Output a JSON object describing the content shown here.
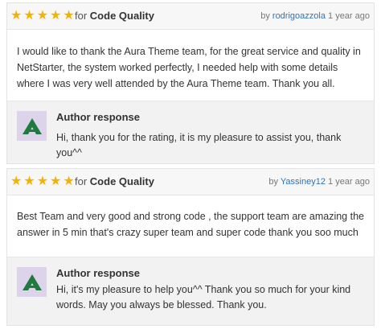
{
  "colors": {
    "star": "#f5b301",
    "link": "#2d73b8",
    "avatar_bg": "#ddd3ea",
    "logo": "#1f7a3e"
  },
  "reviews": [
    {
      "stars": 5,
      "for_label": "for",
      "category": "Code Quality",
      "by_label": "by",
      "author": "rodrigoazzola",
      "time": "1 year ago",
      "text": "I would like to thank the Aura Theme team, for the great service and quality in NetStarter, the system worked perfectly, I needed help with some details where I was very well attended by the Aura Theme team. Thank you all.",
      "response": {
        "title": "Author response",
        "text": "Hi, thank you for the rating, it is my pleasure to assist you, thank you^^"
      }
    },
    {
      "stars": 5,
      "for_label": "for",
      "category": "Code Quality",
      "by_label": "by",
      "author": "Yassiney12",
      "time": "1 year ago",
      "text": "Best Team and very good and strong code , the support team are amazing the answer in 5 min that's crazy super team and super code thank you soo much",
      "response": {
        "title": "Author response",
        "text": "Hi, it's my pleasure to help you^^ Thank you so much for your kind words. May you always be blessed. Thank you."
      }
    }
  ]
}
